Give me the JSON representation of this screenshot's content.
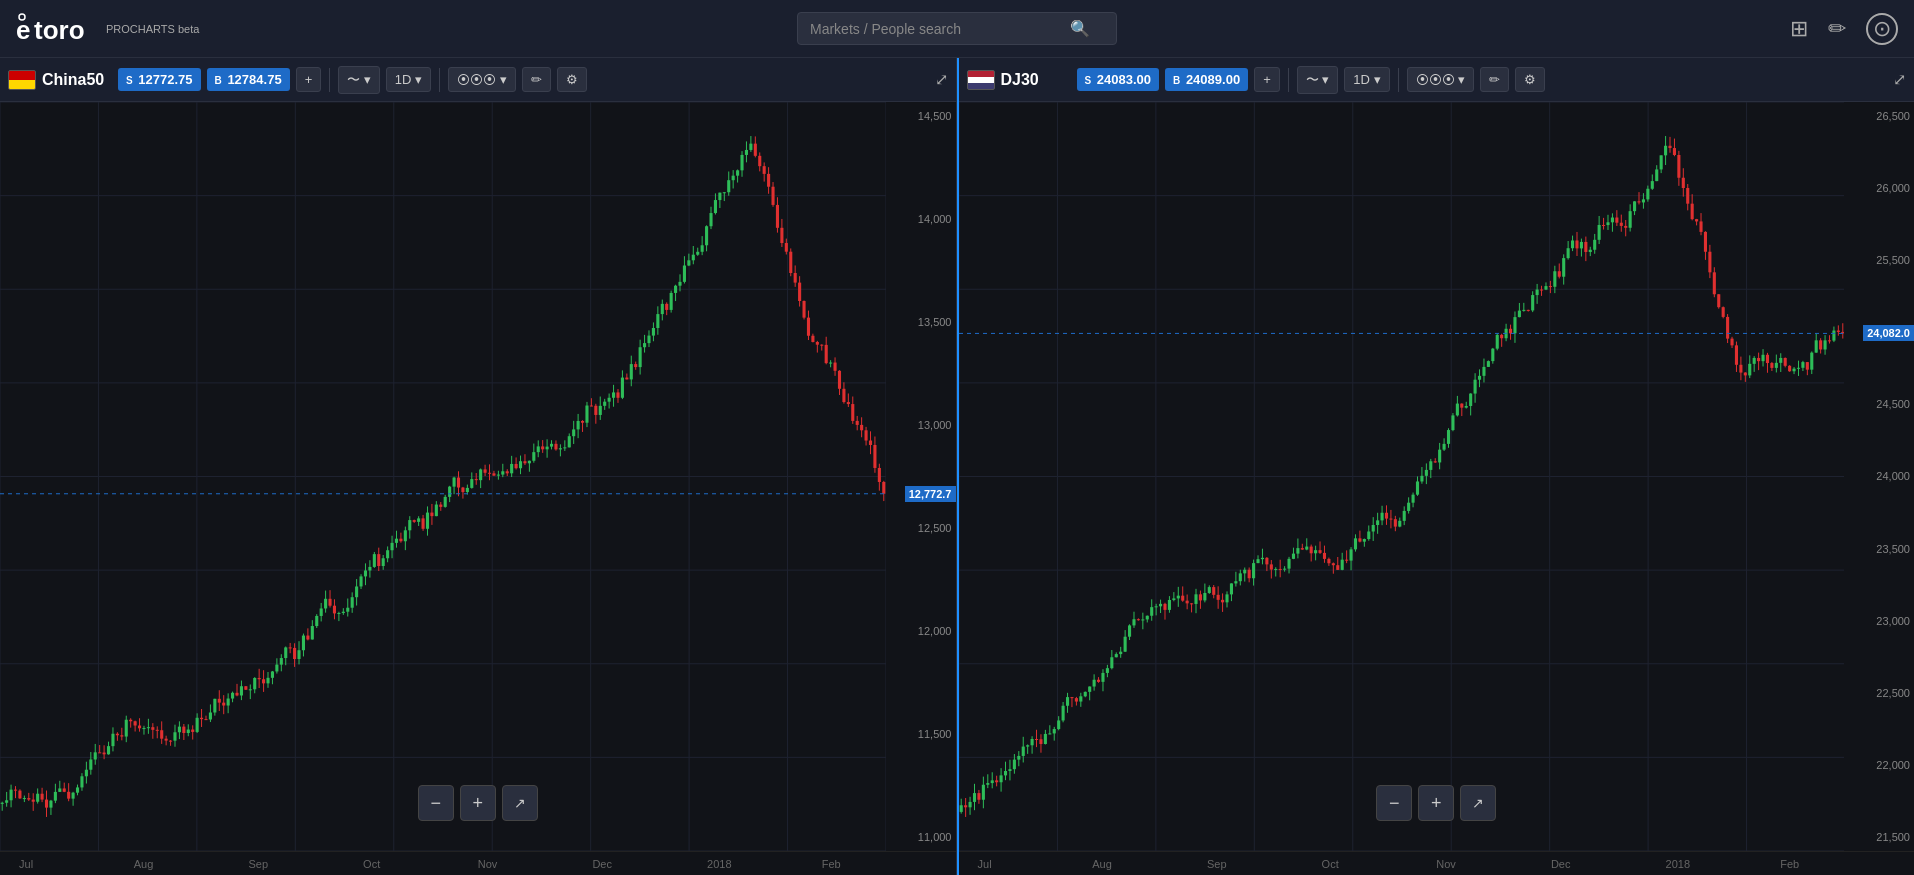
{
  "app": {
    "logo": "eToro",
    "badge": "PROCHARTS beta"
  },
  "search": {
    "placeholder": "Markets / People search"
  },
  "nav_icons": {
    "grid": "⊞",
    "pencil": "✏",
    "user_circle": "⊙"
  },
  "charts": [
    {
      "id": "china50",
      "instrument": "China50",
      "flag_type": "china",
      "sell_label": "S",
      "sell_price": "12772.75",
      "buy_label": "B",
      "buy_price": "12784.75",
      "interval": "1D",
      "current_price": "12,772.7",
      "current_price_tag_top_pct": 56,
      "price_scale": [
        "14,500",
        "14,000",
        "13,500",
        "13,000",
        "12,500",
        "12,000",
        "11,500",
        "11,000"
      ],
      "time_labels": [
        {
          "label": "Jul",
          "left_pct": 2
        },
        {
          "label": "Aug",
          "left_pct": 14
        },
        {
          "label": "Sep",
          "left_pct": 26
        },
        {
          "label": "Oct",
          "left_pct": 38
        },
        {
          "label": "Nov",
          "left_pct": 50
        },
        {
          "label": "Dec",
          "left_pct": 62
        },
        {
          "label": "2018",
          "left_pct": 74
        },
        {
          "label": "Feb",
          "left_pct": 86
        }
      ]
    },
    {
      "id": "dj30",
      "instrument": "DJ30",
      "flag_type": "dj30",
      "sell_label": "S",
      "sell_price": "24083.00",
      "buy_label": "B",
      "buy_price": "24089.00",
      "interval": "1D",
      "current_price": "24,082.0",
      "current_price_tag_top_pct": 49,
      "price_scale": [
        "26,500",
        "26,000",
        "25,500",
        "25,000",
        "24,500",
        "24,000",
        "23,500",
        "23,000",
        "22,500",
        "22,000",
        "21,500"
      ],
      "time_labels": [
        {
          "label": "Jul",
          "left_pct": 2
        },
        {
          "label": "Aug",
          "left_pct": 14
        },
        {
          "label": "Sep",
          "left_pct": 26
        },
        {
          "label": "Oct",
          "left_pct": 38
        },
        {
          "label": "Nov",
          "left_pct": 50
        },
        {
          "label": "Dec",
          "left_pct": 62
        },
        {
          "label": "2018",
          "left_pct": 74
        },
        {
          "label": "Feb",
          "left_pct": 86
        }
      ]
    }
  ],
  "toolbar": {
    "add_label": "+",
    "wave_label": "~",
    "interval_label": "1D",
    "candle_label": "|||",
    "pencil_label": "✏",
    "settings_label": "⚙",
    "expand_label": "⤢",
    "zoom_minus": "−",
    "zoom_plus": "+",
    "share_label": "↗"
  }
}
